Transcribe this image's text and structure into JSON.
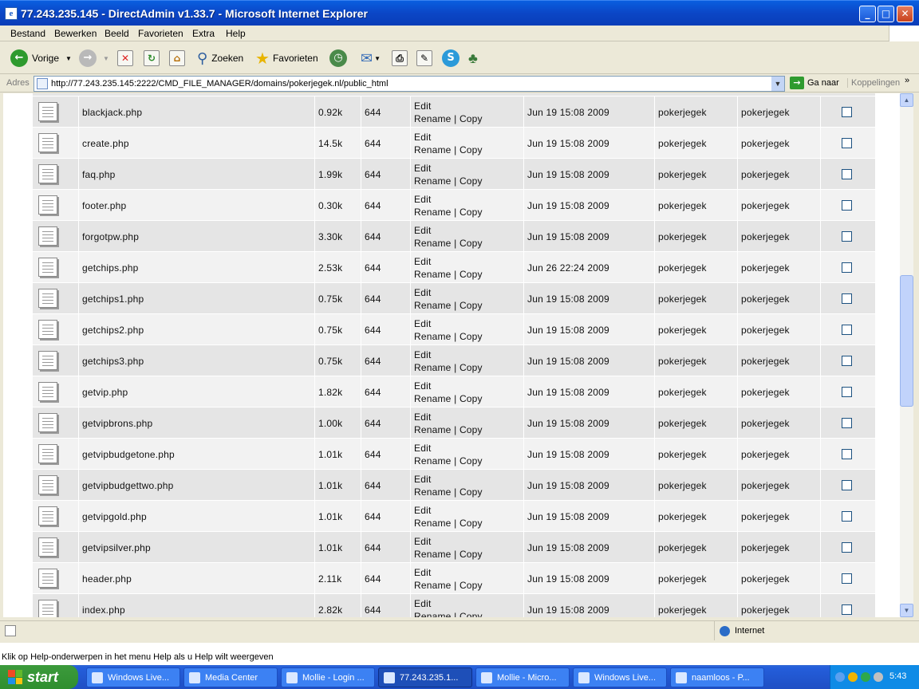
{
  "window": {
    "title": "77.243.235.145 - DirectAdmin v1.33.7 - Microsoft Internet Explorer",
    "minimize": "_",
    "maximize": "□",
    "close": "✕"
  },
  "menu": [
    "Bestand",
    "Bewerken",
    "Beeld",
    "Favorieten",
    "Extra",
    "Help"
  ],
  "toolbar": {
    "back_label": "Vorige",
    "search_label": "Zoeken",
    "favorites_label": "Favorieten"
  },
  "address": {
    "label": "Adres",
    "url": "http://77.243.235.145:2222/CMD_FILE_MANAGER/domains/pokerjegek.nl/public_html",
    "go_label": "Ga naar",
    "links_label": "Koppelingen"
  },
  "files": [
    {
      "name": "blackjack.php",
      "size": "0.92k",
      "perm": "644",
      "edit": "Edit",
      "actions": "Rename | Copy",
      "date": "Jun 19 15:08 2009",
      "owner": "pokerjegek",
      "group": "pokerjegek"
    },
    {
      "name": "create.php",
      "size": "14.5k",
      "perm": "644",
      "edit": "Edit",
      "actions": "Rename | Copy",
      "date": "Jun 19 15:08 2009",
      "owner": "pokerjegek",
      "group": "pokerjegek"
    },
    {
      "name": "faq.php",
      "size": "1.99k",
      "perm": "644",
      "edit": "Edit",
      "actions": "Rename | Copy",
      "date": "Jun 19 15:08 2009",
      "owner": "pokerjegek",
      "group": "pokerjegek"
    },
    {
      "name": "footer.php",
      "size": "0.30k",
      "perm": "644",
      "edit": "Edit",
      "actions": "Rename | Copy",
      "date": "Jun 19 15:08 2009",
      "owner": "pokerjegek",
      "group": "pokerjegek"
    },
    {
      "name": "forgotpw.php",
      "size": "3.30k",
      "perm": "644",
      "edit": "Edit",
      "actions": "Rename | Copy",
      "date": "Jun 19 15:08 2009",
      "owner": "pokerjegek",
      "group": "pokerjegek"
    },
    {
      "name": "getchips.php",
      "size": "2.53k",
      "perm": "644",
      "edit": "Edit",
      "actions": "Rename | Copy",
      "date": "Jun 26 22:24 2009",
      "owner": "pokerjegek",
      "group": "pokerjegek"
    },
    {
      "name": "getchips1.php",
      "size": "0.75k",
      "perm": "644",
      "edit": "Edit",
      "actions": "Rename | Copy",
      "date": "Jun 19 15:08 2009",
      "owner": "pokerjegek",
      "group": "pokerjegek"
    },
    {
      "name": "getchips2.php",
      "size": "0.75k",
      "perm": "644",
      "edit": "Edit",
      "actions": "Rename | Copy",
      "date": "Jun 19 15:08 2009",
      "owner": "pokerjegek",
      "group": "pokerjegek"
    },
    {
      "name": "getchips3.php",
      "size": "0.75k",
      "perm": "644",
      "edit": "Edit",
      "actions": "Rename | Copy",
      "date": "Jun 19 15:08 2009",
      "owner": "pokerjegek",
      "group": "pokerjegek"
    },
    {
      "name": "getvip.php",
      "size": "1.82k",
      "perm": "644",
      "edit": "Edit",
      "actions": "Rename | Copy",
      "date": "Jun 19 15:08 2009",
      "owner": "pokerjegek",
      "group": "pokerjegek"
    },
    {
      "name": "getvipbrons.php",
      "size": "1.00k",
      "perm": "644",
      "edit": "Edit",
      "actions": "Rename | Copy",
      "date": "Jun 19 15:08 2009",
      "owner": "pokerjegek",
      "group": "pokerjegek"
    },
    {
      "name": "getvipbudgetone.php",
      "size": "1.01k",
      "perm": "644",
      "edit": "Edit",
      "actions": "Rename | Copy",
      "date": "Jun 19 15:08 2009",
      "owner": "pokerjegek",
      "group": "pokerjegek"
    },
    {
      "name": "getvipbudgettwo.php",
      "size": "1.01k",
      "perm": "644",
      "edit": "Edit",
      "actions": "Rename | Copy",
      "date": "Jun 19 15:08 2009",
      "owner": "pokerjegek",
      "group": "pokerjegek"
    },
    {
      "name": "getvipgold.php",
      "size": "1.01k",
      "perm": "644",
      "edit": "Edit",
      "actions": "Rename | Copy",
      "date": "Jun 19 15:08 2009",
      "owner": "pokerjegek",
      "group": "pokerjegek"
    },
    {
      "name": "getvipsilver.php",
      "size": "1.01k",
      "perm": "644",
      "edit": "Edit",
      "actions": "Rename | Copy",
      "date": "Jun 19 15:08 2009",
      "owner": "pokerjegek",
      "group": "pokerjegek"
    },
    {
      "name": "header.php",
      "size": "2.11k",
      "perm": "644",
      "edit": "Edit",
      "actions": "Rename | Copy",
      "date": "Jun 19 15:08 2009",
      "owner": "pokerjegek",
      "group": "pokerjegek"
    },
    {
      "name": "index.php",
      "size": "2.82k",
      "perm": "644",
      "edit": "Edit",
      "actions": "Rename | Copy",
      "date": "Jun 19 15:08 2009",
      "owner": "pokerjegek",
      "group": "pokerjegek"
    }
  ],
  "status": {
    "zone": "Internet",
    "help": "Klik op Help-onderwerpen in het menu Help als u Help wilt weergeven"
  },
  "taskbar": {
    "start": "start",
    "tasks": [
      "Windows Live...",
      "Media Center",
      "Mollie - Login ...",
      "77.243.235.1...",
      "Mollie - Micro...",
      "Windows Live...",
      "naamloos - P..."
    ],
    "clock": "5:43"
  },
  "colors": {
    "title_blue": "#0b46c6",
    "row_light": "#f2f2f2",
    "row_dark": "#e5e5e5",
    "taskbar": "#245edb",
    "start_green": "#2f8f2f"
  }
}
